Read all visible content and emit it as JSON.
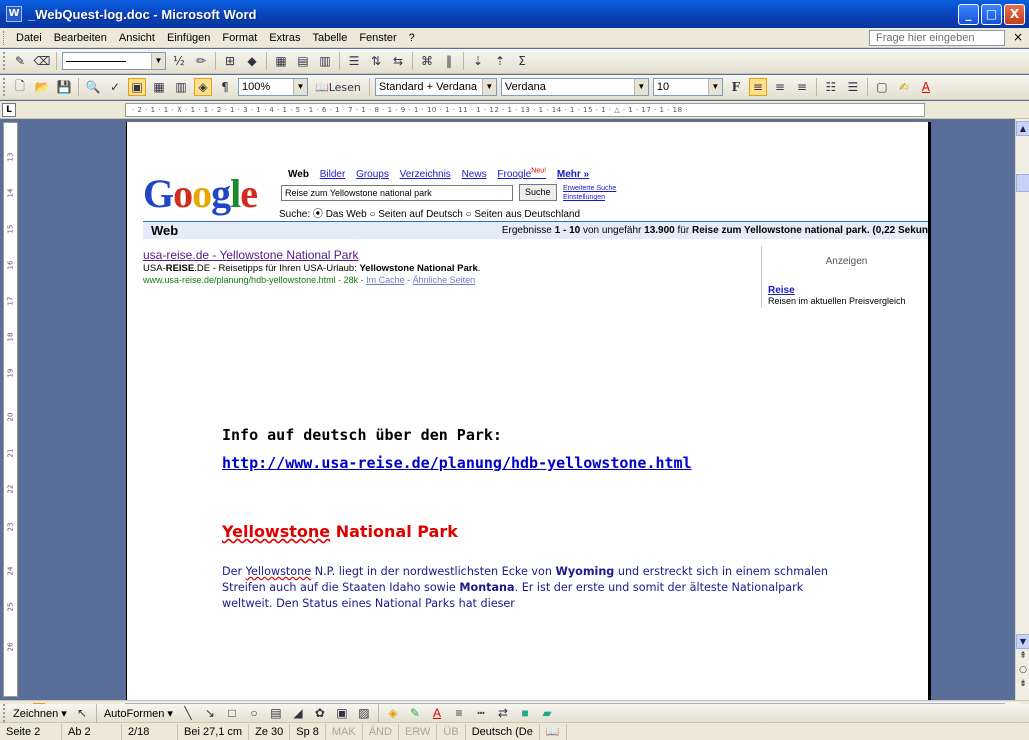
{
  "window": {
    "title": "_WebQuest-log.doc - Microsoft Word",
    "app_icon": "W",
    "controls": {
      "minimize": "_",
      "maximize": "□",
      "close": "X"
    }
  },
  "menubar": {
    "items": [
      "Datei",
      "Bearbeiten",
      "Ansicht",
      "Einfügen",
      "Format",
      "Extras",
      "Tabelle",
      "Fenster",
      "?"
    ],
    "help_placeholder": "Frage hier eingeben",
    "close_glyph": "×"
  },
  "toolbar_formatting": {
    "zoom": "100%",
    "read_button": "Lesen",
    "style": "Standard + Verdana",
    "font": "Verdana",
    "size": "10",
    "bold": "F",
    "fraction": "½"
  },
  "ruler": {
    "corner": "L",
    "h_text": "· 2 · 1 · 1 · ⊼ · 1 · 1 · 2 · 1 · 3 · 1 · 4 · 1 · 5 · 1 · 6 · 1 · 7 · 1 · 8 · 1 · 9 · 1 · 10 · 1 · 11 · 1 · 12 · 1 · 13 · 1 · 14 · 1 · 15 · 1 · △ · 1 · 17 · 1 · 18 ·",
    "v_marks": [
      "13",
      "14",
      "15",
      "16",
      "17",
      "18",
      "19",
      "20",
      "21",
      "22",
      "23",
      "24",
      "25",
      "26"
    ]
  },
  "google": {
    "logo": [
      "G",
      "o",
      "o",
      "g",
      "l",
      "e"
    ],
    "tabs": {
      "current": "Web",
      "items": [
        "Bilder",
        "Groups",
        "Verzeichnis",
        "News"
      ],
      "froogle": "Froogle",
      "froogle_badge": "Neu!",
      "more": "Mehr »"
    },
    "query": "Reise zum Yellowstone national park",
    "submit": "Suche",
    "advanced": "Erweiterte Suche",
    "settings": "Einstellungen",
    "scope_label": "Suche:",
    "scope_options": [
      "Das Web",
      "Seiten auf Deutsch",
      "Seiten aus Deutschland"
    ],
    "bar_label": "Web",
    "results_pre": "Ergebnisse ",
    "results_range": "1 - 10",
    "results_mid": " von ungefähr ",
    "results_count": "13.900",
    "results_for": " für ",
    "results_query": "Reise zum Yellowstone national park",
    "results_time": ". (0,22 Sekun",
    "result": {
      "title": "usa-reise.de - Yellowstone National Park",
      "desc_pre": "USA-",
      "desc_bold1": "REISE",
      "desc_mid": ".DE - Reisetipps für Ihren USA-Urlaub: ",
      "desc_bold2": "Yellowstone National Park",
      "desc_end": ".",
      "url": "www.usa-reise.de/planung/hdb-yellowstone.html - 28k - ",
      "cache": "Im Cache",
      "sep": " - ",
      "similar": "Ähnliche Seiten"
    },
    "ads": {
      "header": "Anzeigen",
      "link": "Reise",
      "snippet": "Reisen im aktuellen Preisvergleich"
    }
  },
  "document": {
    "info_heading": "Info auf deutsch über den Park:",
    "link": "http://www.usa-reise.de/planung/hdb-yellowstone.html",
    "heading_word": "Yellowstone",
    "heading_rest": " National Park",
    "para_1": "Der ",
    "para_ys": "Yellowstone",
    "para_2": " N.P. liegt in der nordwestlichsten Ecke von ",
    "para_wy": "Wyoming",
    "para_3": " und erstreckt sich in einem schmalen Streifen auch auf die Staaten Idaho sowie ",
    "para_mt": "Montana",
    "para_4": ". Er ist der erste und somit der älteste Nationalpark weltweit. Den Status eines National Parks hat dieser"
  },
  "drawbar": {
    "draw": "Zeichnen ▾",
    "autoshapes": "AutoFormen ▾"
  },
  "status": {
    "page": "Seite 2",
    "section": "Ab 2",
    "pages": "2/18",
    "position": "Bei 27,1 cm",
    "line": "Ze 30",
    "col": "Sp 8",
    "mak": "MAK",
    "and": "ÄND",
    "erw": "ERW",
    "ub": "ÜB",
    "lang": "Deutsch (De"
  },
  "colors": {
    "title_bar": "#0a4fd0",
    "heading_red": "#e00000",
    "body_text": "#1a1a8c",
    "link_blue": "#0000cc"
  }
}
